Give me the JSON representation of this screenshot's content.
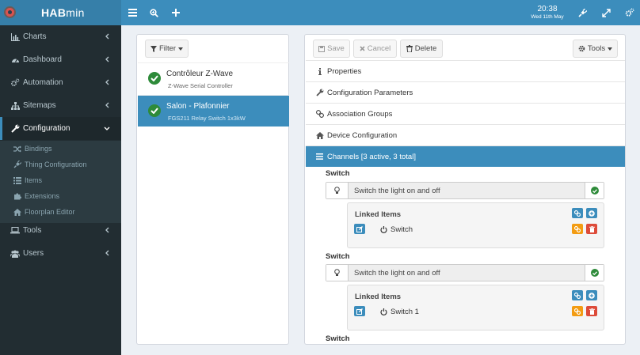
{
  "app": {
    "logo_bold": "HAB",
    "logo_light": "min"
  },
  "header": {
    "time": "20:38",
    "date": "Wed 11th May"
  },
  "colors": {
    "primary": "#3c8dbc",
    "sidebar": "#222d32",
    "success": "#2e8b3a",
    "warning": "#f39c12",
    "danger": "#dd4b39"
  },
  "sidebar": {
    "items": [
      {
        "label": "Charts",
        "icon": "bar-chart-icon"
      },
      {
        "label": "Dashboard",
        "icon": "dashboard-icon"
      },
      {
        "label": "Automation",
        "icon": "cogs-icon"
      },
      {
        "label": "Sitemaps",
        "icon": "sitemap-icon"
      },
      {
        "label": "Configuration",
        "icon": "wrench-icon"
      },
      {
        "label": "Tools",
        "icon": "laptop-icon"
      },
      {
        "label": "Users",
        "icon": "users-icon"
      }
    ],
    "submenu": [
      {
        "label": "Bindings",
        "icon": "shuffle-icon"
      },
      {
        "label": "Thing Configuration",
        "icon": "plug-icon"
      },
      {
        "label": "Items",
        "icon": "list-icon"
      },
      {
        "label": "Extensions",
        "icon": "puzzle-icon"
      },
      {
        "label": "Floorplan Editor",
        "icon": "home-icon"
      }
    ]
  },
  "left": {
    "filter_label": "Filter",
    "devices": [
      {
        "name": "Contrôleur Z-Wave",
        "sub": "Z-Wave Serial Controller"
      },
      {
        "name": "Salon - Plafonnier",
        "sub": "FGS211 Relay Switch 1x3kW"
      }
    ]
  },
  "toolbar": {
    "save": "Save",
    "cancel": "Cancel",
    "delete": "Delete",
    "tools": "Tools"
  },
  "sections": [
    {
      "label": "Properties",
      "icon": "info-icon"
    },
    {
      "label": "Configuration Parameters",
      "icon": "wrench-icon"
    },
    {
      "label": "Association Groups",
      "icon": "link-icon"
    },
    {
      "label": "Device Configuration",
      "icon": "home-icon"
    },
    {
      "label": "Channels [3 active, 3 total]",
      "icon": "bars-icon"
    }
  ],
  "channels": [
    {
      "title": "Switch",
      "description": "Switch the light on and off",
      "linked_title": "Linked Items",
      "item": "Switch"
    },
    {
      "title": "Switch",
      "description": "Switch the light on and off",
      "linked_title": "Linked Items",
      "item": "Switch 1"
    },
    {
      "title": "Switch"
    }
  ]
}
